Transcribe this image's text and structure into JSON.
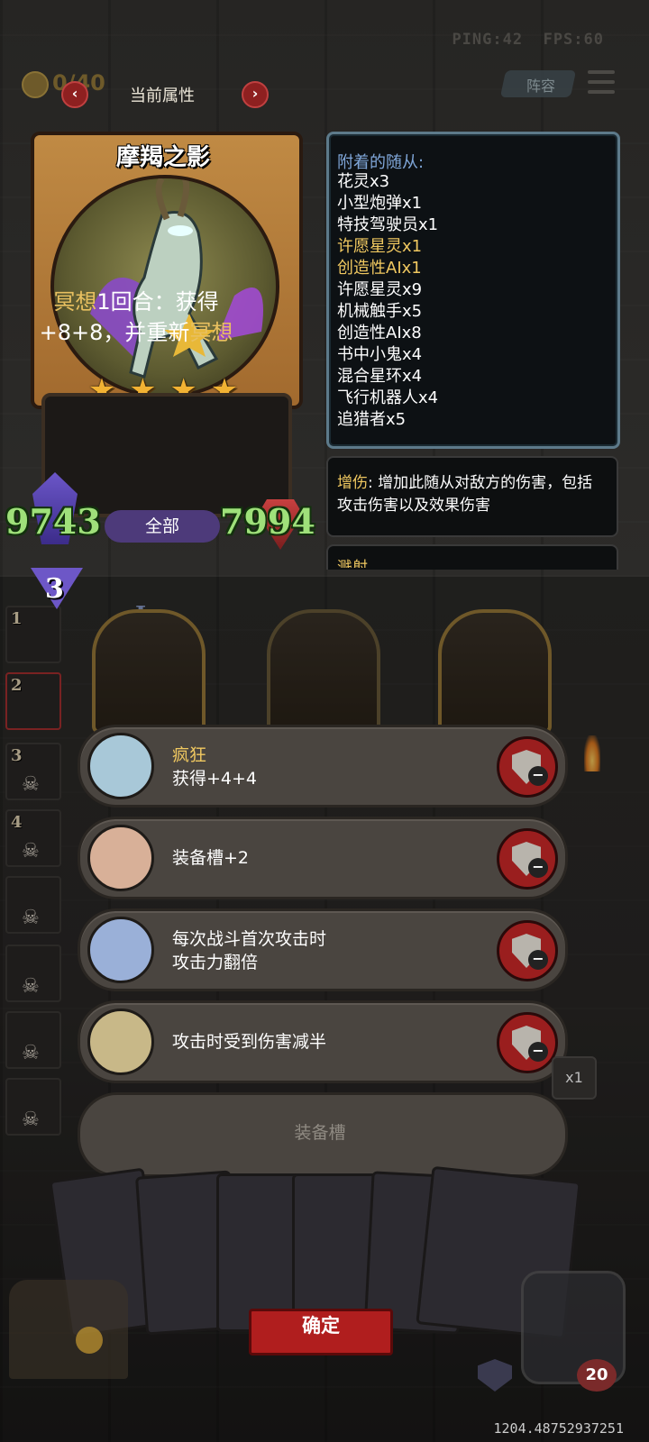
{
  "hud": {
    "ping": "PING:42",
    "fps": "FPS:60",
    "coins": "0/40",
    "lineup_label": "阵容"
  },
  "header": {
    "title": "当前属性"
  },
  "card": {
    "name": "摩羯之影",
    "stars": 4,
    "desc_kw1": "冥想",
    "desc_part1": "1回合：获得",
    "desc_part2": "+8+8，并重新",
    "desc_kw2": "冥想",
    "attack": "9743",
    "health": "7994",
    "tab_label": "全部",
    "tier": "3"
  },
  "minions": {
    "title": "附着的随从:",
    "items": [
      {
        "label": "花灵x3",
        "highlight": false
      },
      {
        "label": "小型炮弹x1",
        "highlight": false
      },
      {
        "label": "特技驾驶员x1",
        "highlight": false
      },
      {
        "label": "许愿星灵x1",
        "highlight": true
      },
      {
        "label": "创造性AIx1",
        "highlight": true
      },
      {
        "label": "许愿星灵x9",
        "highlight": false
      },
      {
        "label": "机械触手x5",
        "highlight": false
      },
      {
        "label": "创造性AIx8",
        "highlight": false
      },
      {
        "label": "书中小鬼x4",
        "highlight": false
      },
      {
        "label": "混合星环x4",
        "highlight": false
      },
      {
        "label": "飞行机器人x4",
        "highlight": false
      },
      {
        "label": "追猎者x5",
        "highlight": false
      }
    ]
  },
  "effect": {
    "keyword": "增伤",
    "text": ": 增加此随从对敌方的伤害，包括攻击伤害以及效果伤害",
    "next_keyword": "溅射"
  },
  "sidebar": {
    "slots": [
      "1",
      "2",
      "3",
      "4",
      "",
      "",
      "",
      ""
    ]
  },
  "board": {
    "marker": "I"
  },
  "equipment": [
    {
      "name": "疯狂",
      "desc": "获得+4+4",
      "icon": "madness-icon"
    },
    {
      "name": "",
      "desc": "装备槽+2",
      "icon": "backpack-icon"
    },
    {
      "name": "",
      "desc": "每次战斗首次攻击时攻击力翻倍",
      "line1": "每次战斗首次攻击时",
      "line2": "攻击力翻倍",
      "icon": "dragon-icon"
    },
    {
      "name": "",
      "desc": "攻击时受到伤害减半",
      "icon": "crossed-swords-icon"
    }
  ],
  "empty_slot_label": "装备槽",
  "confirm_label": "确定",
  "multiplier_label": "x1",
  "player": {
    "hp": "20",
    "gold_marker": "1"
  },
  "coords_text": "1204.48752937251",
  "colors": {
    "accent_gold": "#f0c860",
    "stat_green": "#9fe07a",
    "confirm_red": "#b01e1e",
    "panel_border": "#5d7a8a"
  }
}
